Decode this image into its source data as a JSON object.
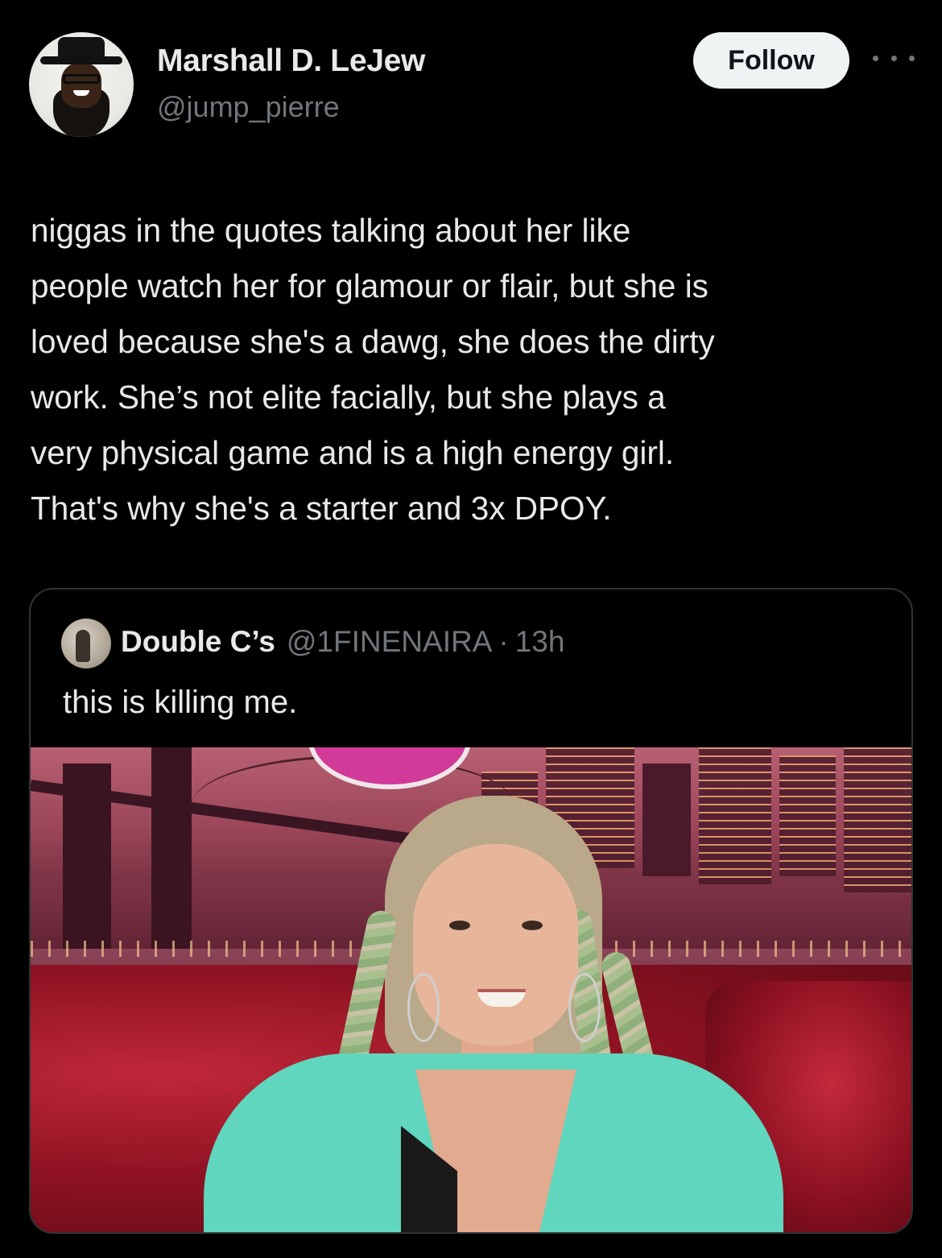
{
  "tweet": {
    "author": {
      "display_name": "Marshall D. LeJew",
      "handle": "@jump_pierre"
    },
    "follow_label": "Follow",
    "more_icon": "more-horizontal-icon",
    "text_lines": [
      "niggas in the quotes talking about her like",
      "people watch her for glamour or flair, but she is",
      "loved because she's a dawg, she does the dirty",
      "work. She’s not elite facially, but she plays a",
      "very physical game and is a high energy girl.",
      "That's why she's a starter and 3x DPOY."
    ]
  },
  "quote": {
    "display_name": "Double C’s",
    "handle": "@1FINENAIRA",
    "separator": "·",
    "time": "13h",
    "text": "this is killing me."
  },
  "colors": {
    "background": "#000000",
    "primary_text": "#e7e9ea",
    "secondary_text": "#71767b",
    "border": "#2f3336",
    "follow_button_bg": "#eff3f4",
    "follow_button_text": "#0f1419"
  }
}
